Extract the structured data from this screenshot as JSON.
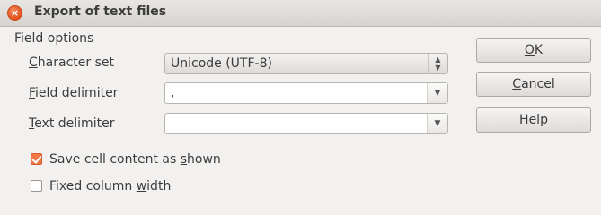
{
  "window": {
    "title": "Export of text files"
  },
  "field_options": {
    "section_label": "Field options",
    "character_set": {
      "label_prefix": "C",
      "label_rest": "haracter set",
      "value": "Unicode (UTF-8)"
    },
    "field_delimiter": {
      "label_prefix": "F",
      "label_rest": "ield delimiter",
      "value": ","
    },
    "text_delimiter": {
      "label_prefix": "T",
      "label_rest": "ext delimiter",
      "value": ""
    },
    "save_cell_content": {
      "label_pre": "Save cell content as ",
      "label_key": "s",
      "label_post": "hown",
      "checked": true
    },
    "fixed_column_width": {
      "label_pre": "Fixed column ",
      "label_key": "w",
      "label_post": "idth",
      "checked": false
    }
  },
  "buttons": {
    "ok": {
      "key": "O",
      "rest": "K"
    },
    "cancel": {
      "key": "C",
      "rest": "ancel"
    },
    "help": {
      "key": "H",
      "rest": "elp"
    }
  },
  "colors": {
    "accent": "#f07746",
    "close": "#e2531d"
  },
  "icons": {
    "close": "close-icon",
    "spin": "spinner-arrows-icon",
    "dropdown": "chevron-down-icon"
  }
}
